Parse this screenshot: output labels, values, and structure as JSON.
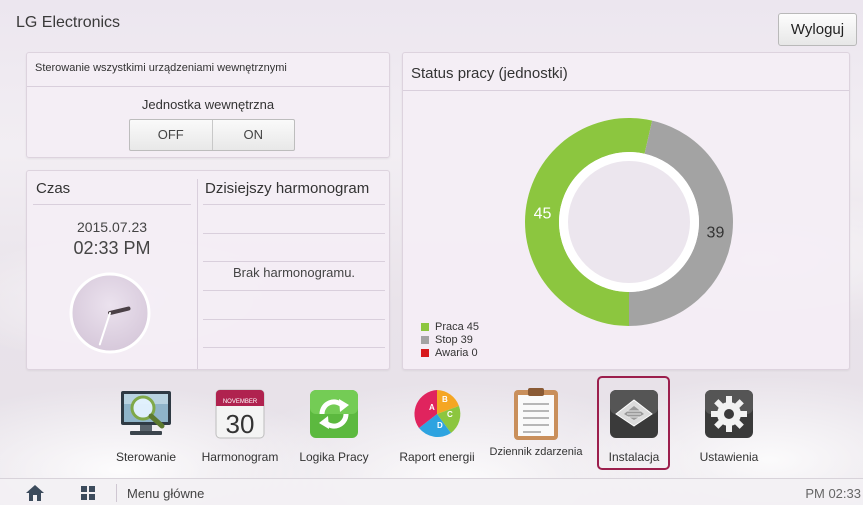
{
  "app": {
    "title": "LG Electronics",
    "logout_label": "Wyloguj"
  },
  "control_panel": {
    "title": "Sterowanie wszystkimi urządzeniami wewnętrznymi",
    "subtitle": "Jednostka wewnętrzna",
    "off_label": "OFF",
    "on_label": "ON"
  },
  "time_panel": {
    "title": "Czas",
    "date": "2015.07.23",
    "time": "02:33 PM",
    "clock": {
      "hour": 14,
      "minute": 33
    }
  },
  "schedule_panel": {
    "title": "Dzisiejszy harmonogram",
    "empty_text": "Brak harmonogramu."
  },
  "status_panel": {
    "title": "Status pracy (jednostki)"
  },
  "chart_data": {
    "type": "pie",
    "title": "Status pracy (jednostki)",
    "labels": [
      "Praca",
      "Stop",
      "Awaria"
    ],
    "values": [
      45,
      39,
      0
    ],
    "data_labels": [
      "45",
      "39",
      ""
    ],
    "legend": [
      "Praca 45",
      "Stop 39",
      "Awaria 0"
    ],
    "colors": [
      "#8cc63f",
      "#a3a3a3",
      "#d7191c"
    ],
    "legend_position": "bottom-left"
  },
  "dock": {
    "items": [
      {
        "label": "Sterowanie",
        "icon": "monitor-magnifier-icon"
      },
      {
        "label": "Harmonogram",
        "icon": "calendar-icon",
        "calendar_month": "NOVEMBER",
        "calendar_day": "30"
      },
      {
        "label": "Logika Pracy",
        "icon": "refresh-cycle-icon"
      },
      {
        "label": "Raport energii",
        "icon": "pie-report-icon",
        "letters": [
          "A",
          "B",
          "C",
          "D"
        ]
      },
      {
        "label": "Dziennik zdarzenia",
        "icon": "clipboard-log-icon"
      },
      {
        "label": "Instalacja",
        "icon": "ceiling-cassette-icon",
        "selected": true
      },
      {
        "label": "Ustawienia",
        "icon": "gear-icon"
      }
    ]
  },
  "bottom_bar": {
    "menu_label": "Menu główne",
    "clock": "PM 02:33"
  }
}
